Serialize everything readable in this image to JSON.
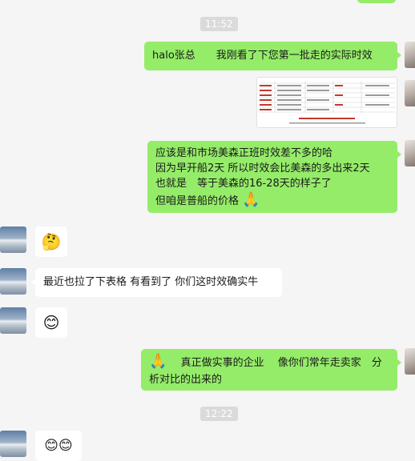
{
  "messages": {
    "time_1": "11:52",
    "msg_1": "halo张总　　我刚看了下您第一批走的实际时效",
    "msg_3_lines": [
      "应该是和市场美森正班时效差不多的哈",
      "因为早开船2天 所以时效会比美森的多出来2天",
      "也就是　等于美森的16-28天的样子了",
      "但咱是普船的价格"
    ],
    "msg_3_emoji": "🙏",
    "sticker_1": "🤔",
    "msg_5": "最近也拉了下表格 有看到了 你们这时效确实牛",
    "sticker_2": "😊",
    "msg_7_lead": "🙏",
    "msg_7_line1": "　真正做实事的企业　 像你们常年走卖家　分",
    "msg_7_line2": "析对比的出来的",
    "time_2": "12:22",
    "sticker_3": "😊😊"
  },
  "colors": {
    "self_bubble": "#95ec69",
    "other_bubble": "#ffffff",
    "background": "#f5f5f5",
    "timestamp_bg": "#dadada"
  }
}
